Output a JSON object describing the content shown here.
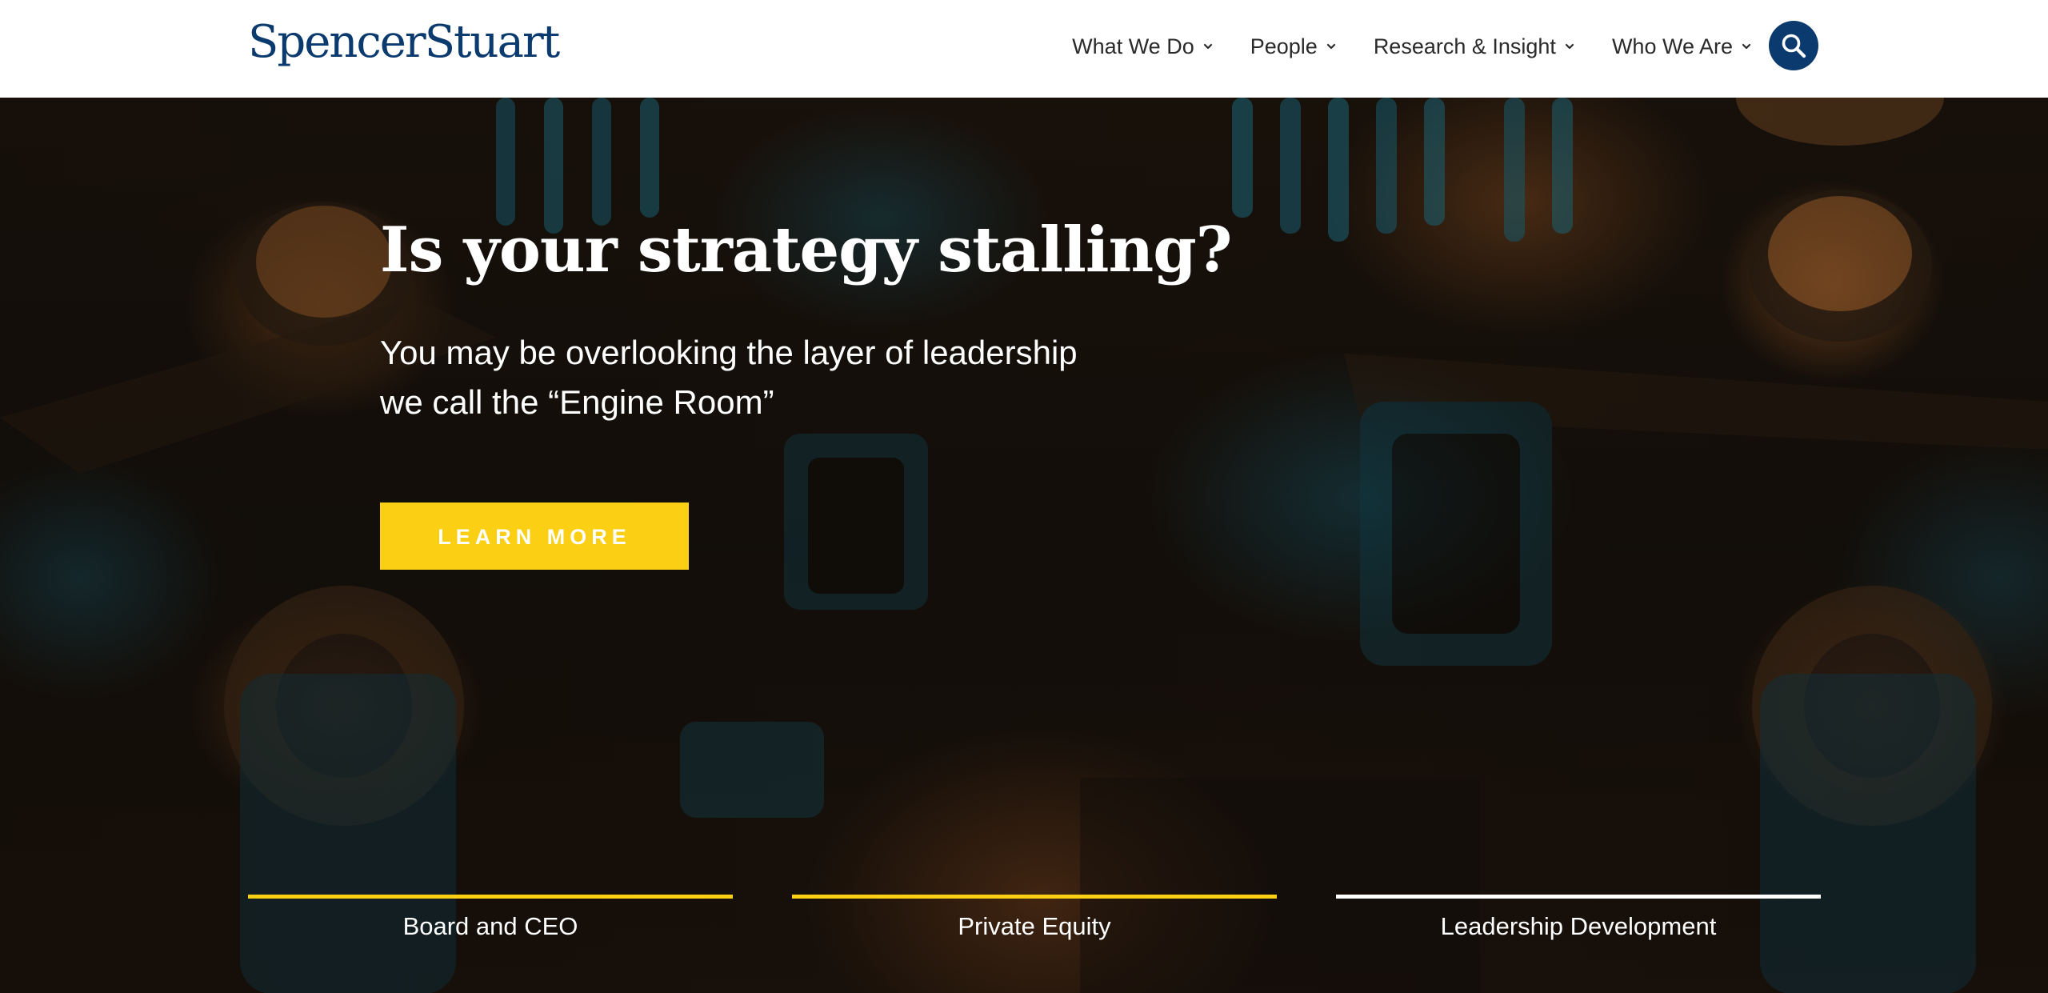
{
  "header": {
    "logo_text": "SpencerStuart",
    "nav": [
      {
        "label": "What We Do",
        "icon": "chevron-down-icon"
      },
      {
        "label": "People",
        "icon": "chevron-down-icon"
      },
      {
        "label": "Research & Insight",
        "icon": "chevron-down-icon"
      },
      {
        "label": "Who We Are",
        "icon": "chevron-down-icon"
      }
    ],
    "search_icon": "search-icon",
    "brand_color": "#0b3a6e"
  },
  "hero": {
    "headline": "Is your strategy stalling?",
    "subhead_line1": "You may be overlooking the layer of leadership",
    "subhead_line2": "we call the “Engine Room”",
    "cta_label": "LEARN MORE",
    "cta_color": "#fbcf13"
  },
  "tabs": [
    {
      "label": "Board and CEO",
      "bar_color": "#fbcf13"
    },
    {
      "label": "Private Equity",
      "bar_color": "#fbcf13"
    },
    {
      "label": "Leadership Development",
      "bar_color": "#ffffff"
    }
  ]
}
